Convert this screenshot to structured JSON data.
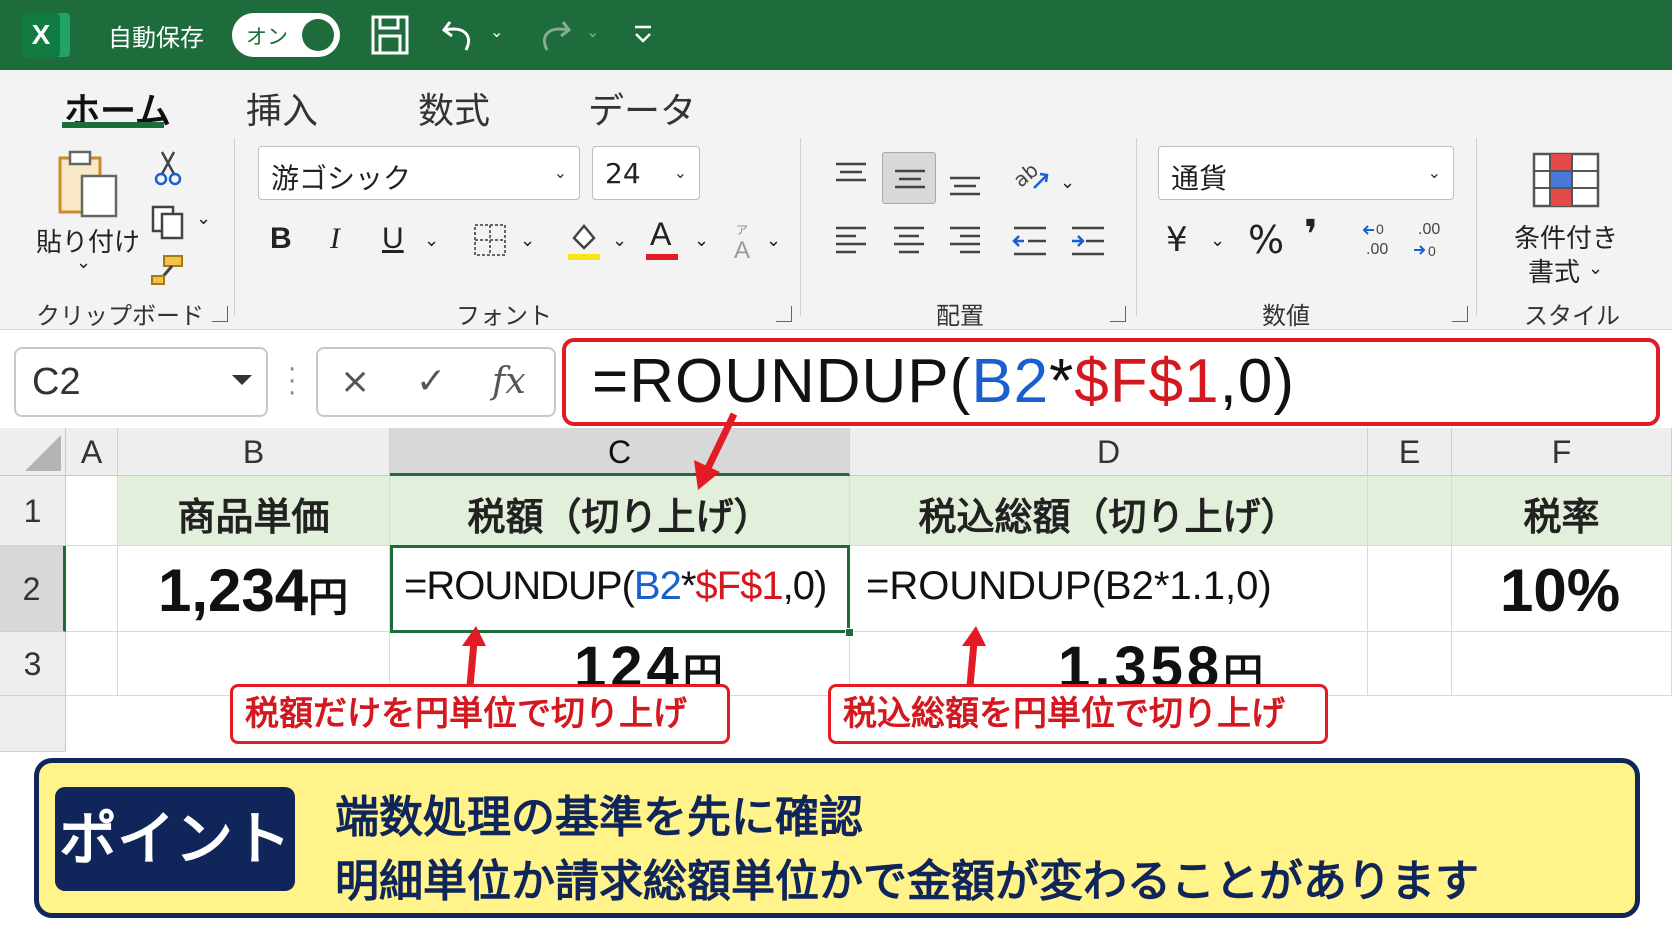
{
  "titlebar": {
    "app_icon": "excel-icon",
    "autosave_label": "自動保存",
    "autosave_toggle": "オン",
    "icons": [
      "save-icon",
      "undo-icon",
      "redo-icon",
      "customize-quick-access-icon"
    ]
  },
  "tabs": [
    {
      "label": "ホーム",
      "active": true
    },
    {
      "label": "挿入"
    },
    {
      "label": "数式"
    },
    {
      "label": "データ"
    }
  ],
  "ribbon": {
    "clipboard": {
      "paste_label": "貼り付け",
      "group_label": "クリップボード"
    },
    "font": {
      "font_name": "游ゴシック",
      "font_size": "24",
      "bold": "B",
      "italic": "I",
      "underline": "U",
      "font_color_letter": "A",
      "group_label": "フォント"
    },
    "alignment": {
      "group_label": "配置"
    },
    "number": {
      "format": "通貨",
      "currency_symbol": "¥",
      "percent_symbol": "%",
      "comma_symbol": "❜",
      "increase_decimal_label": "←0\n.00",
      "decrease_decimal_label": ".00\n→0",
      "group_label": "数値"
    },
    "styles": {
      "conditional_format_line1": "条件付き",
      "conditional_format_line2": "書式",
      "group_label": "スタイル"
    }
  },
  "formula_bar": {
    "name_box": "C2",
    "cancel": "×",
    "enter": "✓",
    "fx": "fx",
    "formula_parts": {
      "p1": "=ROUNDUP(",
      "p2": "B2",
      "p3": "*",
      "p4": "$F$1",
      "p5": ",0)"
    }
  },
  "sheet": {
    "columns": [
      "A",
      "B",
      "C",
      "D",
      "E",
      "F"
    ],
    "rows": [
      "1",
      "2",
      "3"
    ],
    "headers": {
      "B1": "商品単価",
      "C1": "税額（切り上げ）",
      "D1": "税込総額（切り上げ）",
      "F1": "税率"
    },
    "B2": {
      "value": "1,234",
      "unit": "円"
    },
    "C2_formula": {
      "p1": "=ROUNDUP(",
      "p2": "B2",
      "p3": "*",
      "p4": "$F$1",
      "p5": ",0)"
    },
    "D2_formula": "=ROUNDUP(B2*1.1,0)",
    "F2": "10%",
    "C3": {
      "value": "124",
      "unit": "円"
    },
    "D3": {
      "value": "1,358",
      "unit": "円"
    }
  },
  "callouts": {
    "left": "税額だけを円単位で切り上げ",
    "right": "税込総額を円単位で切り上げ"
  },
  "point": {
    "badge": "ポイント",
    "line1": "端数処理の基準を先に確認",
    "line2": "明細単位か請求総額単位かで金額が変わることがあります"
  },
  "colors": {
    "excel_green": "#1e6b3c",
    "header_fill": "#e2efda",
    "highlight_red": "#e21b24",
    "ref_blue": "#1a5fd0",
    "point_navy": "#10265a",
    "point_yellow": "#fff389"
  }
}
